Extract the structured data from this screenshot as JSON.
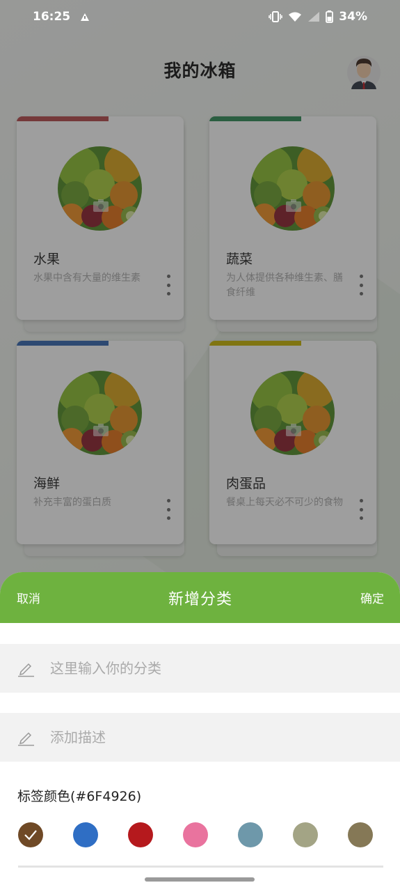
{
  "status_bar": {
    "time": "16:25",
    "battery": "34%",
    "icons": [
      "alert-icon",
      "vibrate-icon",
      "wifi-icon",
      "signal-icon",
      "battery-icon"
    ]
  },
  "header": {
    "title": "我的冰箱"
  },
  "categories": [
    {
      "name": "水果",
      "desc": "水果中含有大量的维生素",
      "accent": "#b5474a"
    },
    {
      "name": "蔬菜",
      "desc": "为人体提供各种维生素、膳食纤维",
      "accent": "#2e8b57"
    },
    {
      "name": "海鲜",
      "desc": "补充丰富的蛋白质",
      "accent": "#3264b0"
    },
    {
      "name": "肉蛋品",
      "desc": "餐桌上每天必不可少的食物",
      "accent": "#c8b400"
    }
  ],
  "sheet": {
    "cancel": "取消",
    "title": "新增分类",
    "confirm": "确定",
    "name_placeholder": "这里输入你的分类",
    "desc_placeholder": "添加描述",
    "color_label": "标签颜色(#6F4926)",
    "colors": [
      "#6F4926",
      "#2f6ec4",
      "#b5191d",
      "#e9739e",
      "#6e98aa",
      "#a3a485",
      "#857856"
    ],
    "selected_color": "#6F4926"
  }
}
